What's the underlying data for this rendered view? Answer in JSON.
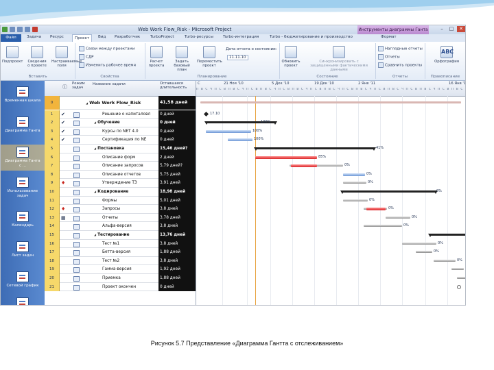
{
  "window": {
    "title": "Web Work Flow_Risk - Microsoft Project",
    "context_tab": "Инструменты диаграммы Ганта"
  },
  "tabs": [
    "Файл",
    "Задача",
    "Ресурс",
    "Проект",
    "Вид",
    "Разработчик",
    "TurboProject",
    "Turbo-ресурсы",
    "Turbo-интеграция",
    "Turbo - бюджетирование и производство",
    "Формат"
  ],
  "ribbon": {
    "insert": {
      "btn1": "Подпроект",
      "btn2": "Сведения о проекте",
      "btn3": "Настраиваемые поля",
      "group": "Вставить"
    },
    "props": {
      "links": "Связи между проектами",
      "wbs": "СДР",
      "worktime": "Изменить рабочее время",
      "group": "Свойства"
    },
    "schedule": {
      "calc": "Расчет проекта",
      "baseline": "Задать базовый план",
      "move": "Переместить проект",
      "status_label": "Дата отчета о состоянии:",
      "status_date": "11.11.10",
      "group": "Планирование"
    },
    "status": {
      "update": "Обновить проект",
      "sync": "Синхронизировать с защищенными фактическими данными",
      "group": "Состояние"
    },
    "reports": {
      "visual": "Наглядные отчеты",
      "reports": "Отчеты",
      "compare": "Сравнить проекты",
      "group": "Отчеты"
    },
    "proofing": {
      "spelling": "Орфография",
      "group": "Правописание"
    }
  },
  "viewbar": [
    {
      "label": "Временная шкала"
    },
    {
      "label": "Диаграмма Ганта"
    },
    {
      "label": "Диаграмма Ганта с ..."
    },
    {
      "label": "Использование задач"
    },
    {
      "label": "Календарь"
    },
    {
      "label": "Лист задач"
    },
    {
      "label": "Сетевой график"
    }
  ],
  "sheet": {
    "col_mode": "Режим задач",
    "col_name": "Название задачи",
    "col_dur": "Оставшаяся длительность",
    "rows": [
      {
        "id": "0",
        "name": "Web Work Flow_Risk",
        "dur": "41,58 дней",
        "bold": true,
        "indent": 0,
        "toggle": true,
        "ind": ""
      },
      {
        "id": "1",
        "name": "Решение о капиталовл",
        "dur": "0 дней",
        "bold": false,
        "indent": 2,
        "ind": "✔"
      },
      {
        "id": "2",
        "name": "Обучение",
        "dur": "0 дней",
        "bold": true,
        "indent": 1,
        "toggle": true,
        "ind": "✔"
      },
      {
        "id": "3",
        "name": "Курсы по NET 4.0",
        "dur": "0 дней",
        "bold": false,
        "indent": 2,
        "ind": "✔"
      },
      {
        "id": "4",
        "name": "Сертификация по NE",
        "dur": "0 дней",
        "bold": false,
        "indent": 2,
        "ind": "✔"
      },
      {
        "id": "5",
        "name": "Постановка",
        "dur": "15,46 дней?",
        "bold": true,
        "indent": 1,
        "toggle": true,
        "ind": ""
      },
      {
        "id": "6",
        "name": "Описание форм",
        "dur": "2 дней",
        "bold": false,
        "indent": 2,
        "ind": ""
      },
      {
        "id": "7",
        "name": "Описание запросов",
        "dur": "5,79 дней?",
        "bold": false,
        "indent": 2,
        "ind": ""
      },
      {
        "id": "8",
        "name": "Описание отчетов",
        "dur": "5,75 дней",
        "bold": false,
        "indent": 2,
        "ind": ""
      },
      {
        "id": "9",
        "name": "Утверждение ТЗ",
        "dur": "3,91 дней",
        "bold": false,
        "indent": 2,
        "ind": "♦"
      },
      {
        "id": "10",
        "name": "Кодирование",
        "dur": "18,98 дней",
        "bold": true,
        "indent": 1,
        "toggle": true,
        "ind": ""
      },
      {
        "id": "11",
        "name": "Формы",
        "dur": "5,01 дней",
        "bold": false,
        "indent": 2,
        "ind": ""
      },
      {
        "id": "12",
        "name": "Запросы",
        "dur": "3,8 дней",
        "bold": false,
        "indent": 2,
        "ind": "♦"
      },
      {
        "id": "13",
        "name": "Отчеты",
        "dur": "3,78 дней",
        "bold": false,
        "indent": 2,
        "ind": "▦"
      },
      {
        "id": "14",
        "name": "Альфа-версия",
        "dur": "3,8 дней",
        "bold": false,
        "indent": 2,
        "ind": ""
      },
      {
        "id": "15",
        "name": "Тестирование",
        "dur": "13,76 дней",
        "bold": true,
        "indent": 1,
        "toggle": true,
        "ind": ""
      },
      {
        "id": "16",
        "name": "Тест №1",
        "dur": "3,8 дней",
        "bold": false,
        "indent": 2,
        "ind": ""
      },
      {
        "id": "17",
        "name": "Бетта-версия",
        "dur": "1,88 дней",
        "bold": false,
        "indent": 2,
        "ind": ""
      },
      {
        "id": "18",
        "name": "Тест №2",
        "dur": "3,8 дней",
        "bold": false,
        "indent": 2,
        "ind": ""
      },
      {
        "id": "19",
        "name": "Гамма-версия",
        "dur": "1,92 дней",
        "bold": false,
        "indent": 2,
        "ind": ""
      },
      {
        "id": "20",
        "name": "Приемка",
        "dur": "1,88 дней",
        "bold": false,
        "indent": 2,
        "ind": ""
      },
      {
        "id": "21",
        "name": "Проект окончен",
        "dur": "0 дней",
        "bold": false,
        "indent": 2,
        "ind": ""
      }
    ]
  },
  "gantt": {
    "weeks": [
      "С",
      "21 Ноя '10",
      "5 Дек '10",
      "19 Дек '10",
      "2 Янв '11",
      "16 Янв '11"
    ],
    "half_weeks": [
      "14 Ноя '10",
      "28 Ноя '10",
      "12 Дек '10",
      "26 Дек '10",
      "9 Янв '11"
    ],
    "day_letters": "ПВСЧПСВПВСЧПСВПВСЧПСВПВСЧПСВПВСЧПСВПВСЧПСВПВСЧПСВПВСЧПСВПВСЧПСВПВСЧПСВ",
    "milestone_label": "17.10",
    "percents": [
      "100%",
      "100%",
      "100%",
      "41%",
      "85%",
      "0%",
      "0%",
      "0%",
      "0%",
      "0%",
      "0%",
      "0%",
      "0%",
      "0%",
      "0%",
      "0%",
      "0%",
      "0%",
      "0%"
    ]
  },
  "caption": "Рисунок 5.7 Представление «Диаграмма Гантта с отслеживанием»"
}
